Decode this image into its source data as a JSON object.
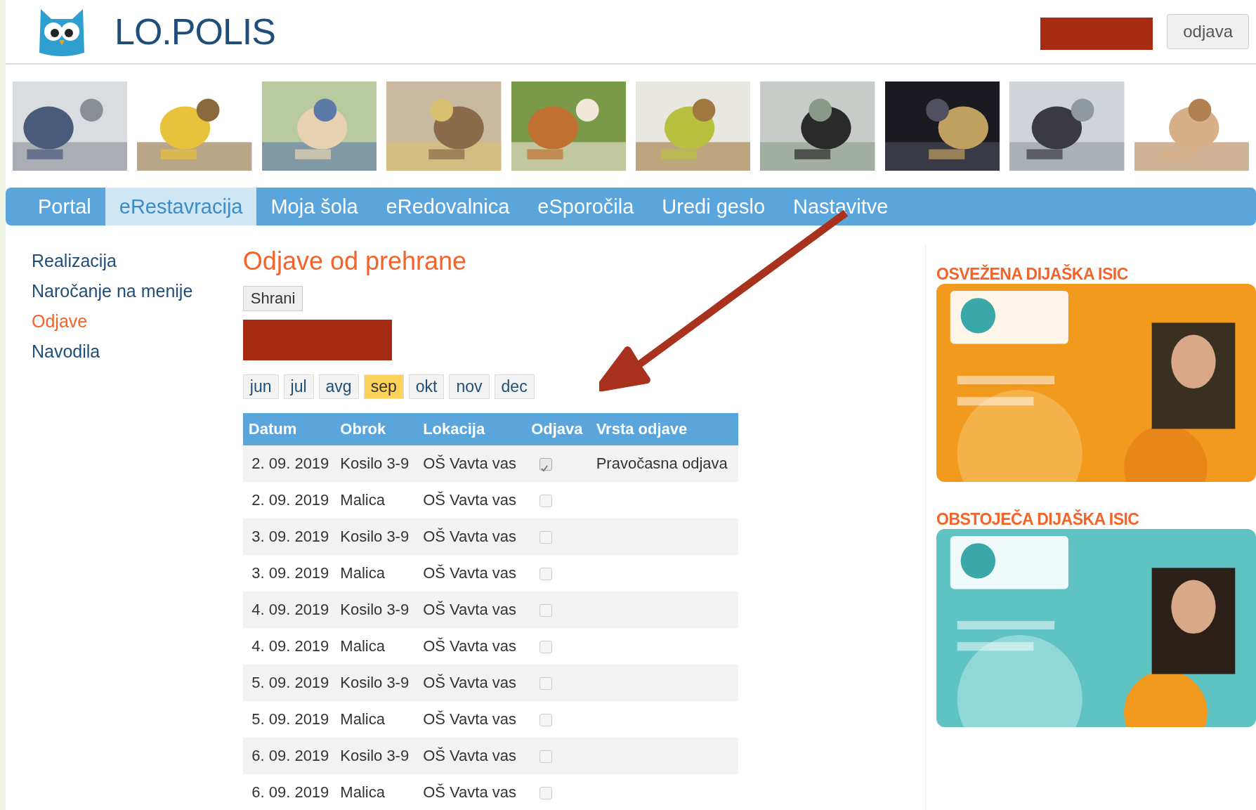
{
  "header": {
    "logo_text": "LO.POLIS",
    "logout_button": "odjava"
  },
  "nav": {
    "tabs": [
      {
        "label": "Portal",
        "selected": false
      },
      {
        "label": "eRestavracija",
        "selected": true
      },
      {
        "label": "Moja šola",
        "selected": false
      },
      {
        "label": "eRedovalnica",
        "selected": false
      },
      {
        "label": "eSporočila",
        "selected": false
      },
      {
        "label": "Uredi geslo",
        "selected": false
      },
      {
        "label": "Nastavitve",
        "selected": false
      }
    ]
  },
  "sidebar": {
    "items": [
      {
        "label": "Realizacija",
        "selected": false
      },
      {
        "label": "Naročanje na menije",
        "selected": false
      },
      {
        "label": "Odjave",
        "selected": true
      },
      {
        "label": "Navodila",
        "selected": false
      }
    ]
  },
  "main": {
    "title": "Odjave od prehrane",
    "save_button": "Shrani",
    "months": [
      {
        "label": "jun",
        "selected": false
      },
      {
        "label": "jul",
        "selected": false
      },
      {
        "label": "avg",
        "selected": false
      },
      {
        "label": "sep",
        "selected": true
      },
      {
        "label": "okt",
        "selected": false
      },
      {
        "label": "nov",
        "selected": false
      },
      {
        "label": "dec",
        "selected": false
      }
    ],
    "table": {
      "columns": [
        "Datum",
        "Obrok",
        "Lokacija",
        "Odjava",
        "Vrsta odjave"
      ],
      "rows": [
        {
          "date": "2. 09. 2019",
          "meal": "Kosilo 3-9",
          "location": "OŠ Vavta vas",
          "checked": true,
          "type": "Pravočasna odjava"
        },
        {
          "date": "2. 09. 2019",
          "meal": "Malica",
          "location": "OŠ Vavta vas",
          "checked": false
        },
        {
          "date": "3. 09. 2019",
          "meal": "Kosilo 3-9",
          "location": "OŠ Vavta vas",
          "checked": false
        },
        {
          "date": "3. 09. 2019",
          "meal": "Malica",
          "location": "OŠ Vavta vas",
          "checked": false
        },
        {
          "date": "4. 09. 2019",
          "meal": "Kosilo 3-9",
          "location": "OŠ Vavta vas",
          "checked": false
        },
        {
          "date": "4. 09. 2019",
          "meal": "Malica",
          "location": "OŠ Vavta vas",
          "checked": false
        },
        {
          "date": "5. 09. 2019",
          "meal": "Kosilo 3-9",
          "location": "OŠ Vavta vas",
          "checked": false
        },
        {
          "date": "5. 09. 2019",
          "meal": "Malica",
          "location": "OŠ Vavta vas",
          "checked": false
        },
        {
          "date": "6. 09. 2019",
          "meal": "Kosilo 3-9",
          "location": "OŠ Vavta vas",
          "checked": false
        },
        {
          "date": "6. 09. 2019",
          "meal": "Malica",
          "location": "OŠ Vavta vas",
          "checked": false
        }
      ]
    }
  },
  "aside": {
    "sections": [
      {
        "heading": "OSVEŽENA DIJAŠKA ISIC"
      },
      {
        "heading": "OBSTOJEČA DIJAŠKA ISIC"
      }
    ]
  }
}
